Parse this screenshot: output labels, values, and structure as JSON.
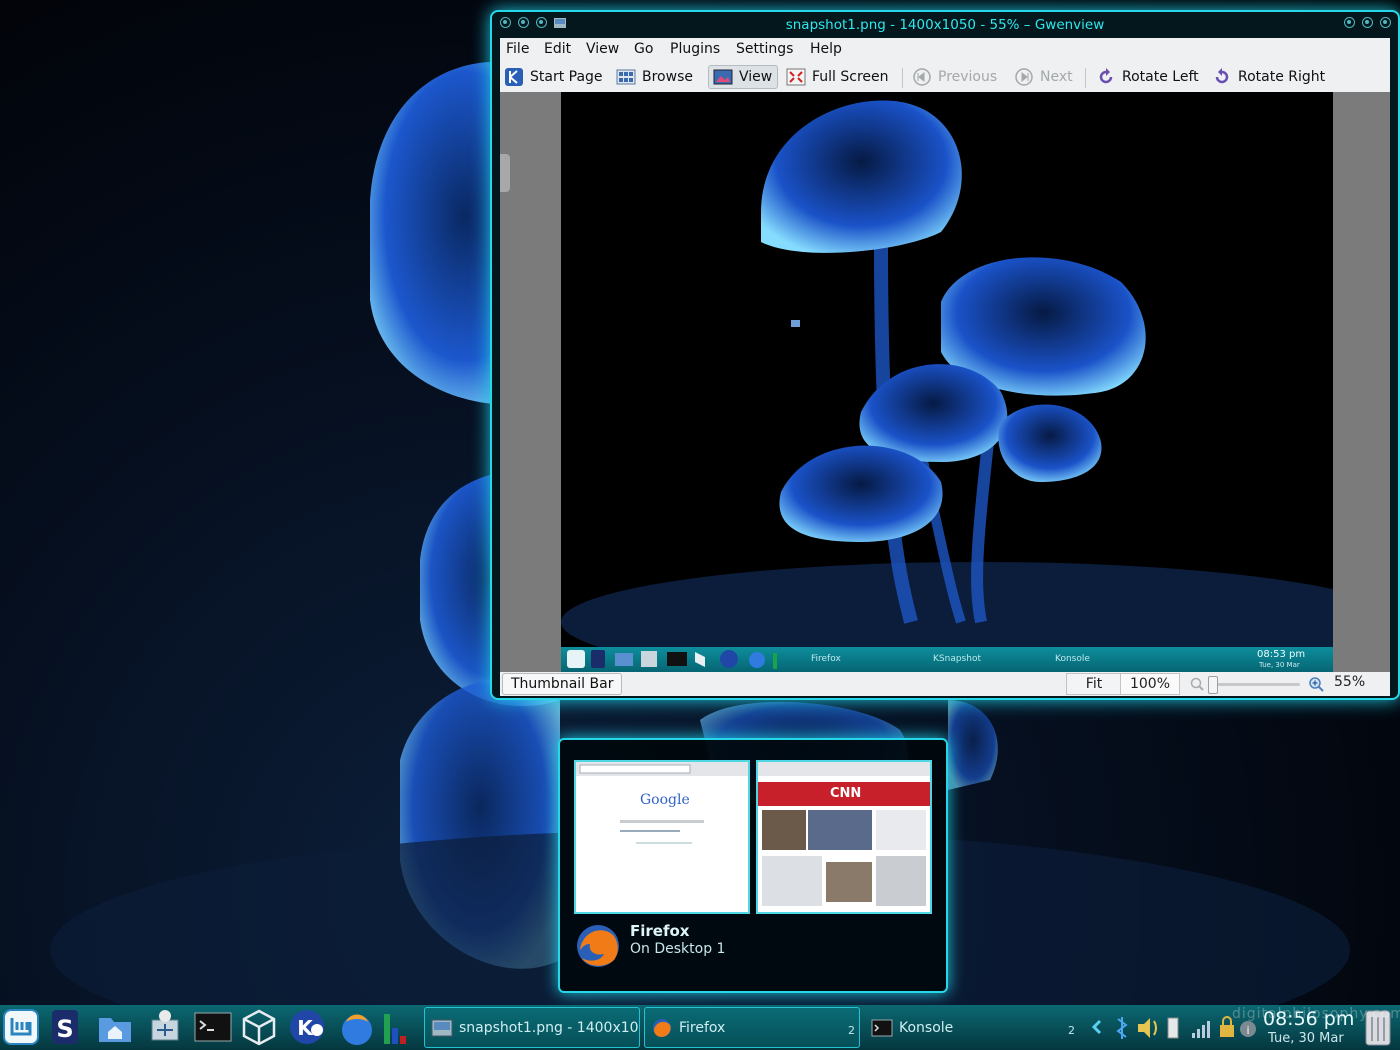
{
  "window": {
    "title": "snapshot1.png - 1400x1050 - 55% – Gwenview"
  },
  "menu": [
    "File",
    "Edit",
    "View",
    "Go",
    "Plugins",
    "Settings",
    "Help"
  ],
  "toolbar": {
    "start_page": "Start Page",
    "browse": "Browse",
    "view": "View",
    "full_screen": "Full Screen",
    "previous": "Previous",
    "next": "Next",
    "rotate_left": "Rotate Left",
    "rotate_right": "Rotate Right"
  },
  "inner_panel": {
    "task1": "Firefox",
    "task2": "KSnapshot",
    "task3": "Konsole",
    "time": "08:53 pm",
    "date": "Tue, 30 Mar"
  },
  "statusbar": {
    "thumbnail_bar": "Thumbnail Bar",
    "fit": "Fit",
    "zoom_100": "100%",
    "zoom_value": "55%"
  },
  "switcher": {
    "title": "Firefox",
    "subtitle": "On Desktop 1",
    "thumb1_logo": "Google",
    "thumb2_logo": "CNN"
  },
  "taskbar": {
    "task1": "snapshot1.png - 1400x10",
    "task2": "Firefox",
    "task2_count": "2",
    "task3": "Konsole",
    "task3_count": "2",
    "time": "08:56 pm",
    "date": "Tue, 30 Mar",
    "watermark": "digitalphilosophy.com"
  },
  "colors": {
    "accent_glow": "#27d7e8",
    "title_text": "#2ee8ee",
    "panel": "#0b6872"
  }
}
